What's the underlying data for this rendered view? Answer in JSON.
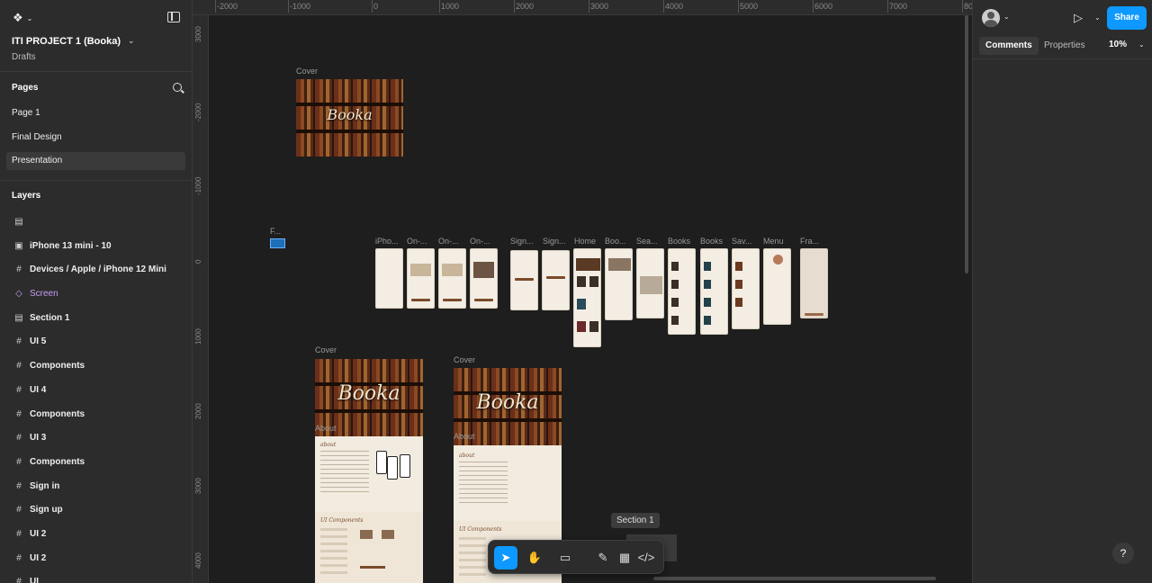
{
  "app": {
    "project_title": "ITI PROJECT 1 (Booka)",
    "project_location": "Drafts"
  },
  "pages": {
    "heading": "Pages",
    "items": [
      "Page 1",
      "Final Design",
      "Presentation"
    ],
    "selected": "Presentation"
  },
  "layers": {
    "heading": "Layers",
    "items": [
      {
        "label": "",
        "icon": "section-icon"
      },
      {
        "label": "iPhone 13 mini - 10",
        "icon": "image-icon"
      },
      {
        "label": "Devices / Apple / iPhone 12 Mini",
        "icon": "frame-icon"
      },
      {
        "label": "Screen",
        "icon": "component-icon"
      },
      {
        "label": "Section 1",
        "icon": "section-icon"
      },
      {
        "label": "UI 5",
        "icon": "frame-icon"
      },
      {
        "label": "Components",
        "icon": "frame-icon"
      },
      {
        "label": "UI 4",
        "icon": "frame-icon"
      },
      {
        "label": "Components",
        "icon": "frame-icon"
      },
      {
        "label": "UI 3",
        "icon": "frame-icon"
      },
      {
        "label": "Components",
        "icon": "frame-icon"
      },
      {
        "label": "Sign in",
        "icon": "frame-icon"
      },
      {
        "label": "Sign up",
        "icon": "frame-icon"
      },
      {
        "label": "UI 2",
        "icon": "frame-icon"
      },
      {
        "label": "UI 2",
        "icon": "frame-icon"
      },
      {
        "label": "UI",
        "icon": "frame-icon"
      }
    ]
  },
  "rulers": {
    "top": [
      "-2000",
      "-1000",
      "0",
      "1000",
      "2000",
      "3000",
      "4000",
      "5000",
      "6000",
      "7000",
      "80"
    ],
    "left": [
      "3000",
      "-2000",
      "-1000",
      "0",
      "1000",
      "2000",
      "3000",
      "4000"
    ]
  },
  "canvas": {
    "cover_top_label": "Cover",
    "cover_top_text": "Booka",
    "small_frame_label": "F...",
    "screen_labels": [
      "iPho...",
      "On-...",
      "On-...",
      "On-...",
      "Sign...",
      "Sign...",
      "Home",
      "Boo...",
      "Sea...",
      "Books",
      "Books",
      "Sav...",
      "Menu",
      "Fra..."
    ],
    "cover_left_label": "Cover",
    "cover_right_label": "Cover",
    "cover_left_text": "Booka",
    "cover_right_text": "Booka",
    "about_label": "About",
    "about_label_2": "About",
    "about_heading": "about",
    "ui_components_heading": "UI Components"
  },
  "toolbar": {
    "tooltip": "Section 1",
    "tools": [
      "move-tool",
      "hand-tool",
      "comment-tool",
      "pen-tool",
      "section-tool",
      "dev-mode-tool"
    ],
    "active": "move-tool"
  },
  "right_panel": {
    "share_label": "Share",
    "tabs": [
      "Comments",
      "Properties"
    ],
    "active_tab": "Comments",
    "zoom": "10%",
    "help_label": "?"
  },
  "colors": {
    "accent": "#0d99ff",
    "panel_bg": "#2c2c2c",
    "canvas_bg": "#1e1e1e",
    "component_purple": "#c79cf3"
  }
}
